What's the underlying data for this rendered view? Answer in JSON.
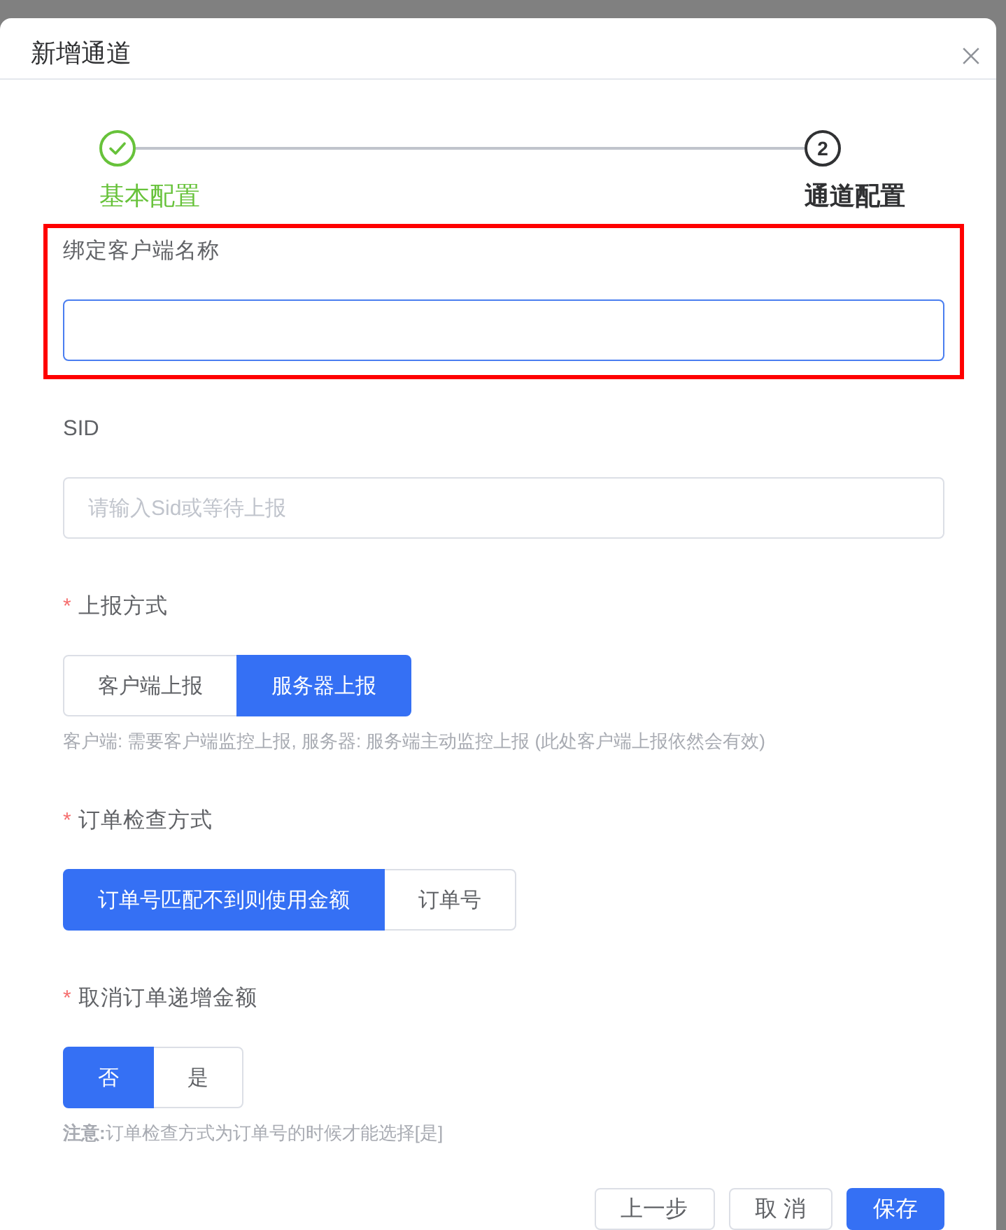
{
  "dialog": {
    "title": "新增通道"
  },
  "steps": [
    {
      "label": "基本配置",
      "finished": true,
      "selected": false
    },
    {
      "number": "2",
      "label": "通道配置",
      "finished": false,
      "selected": true
    }
  ],
  "fields": [
    {
      "kind": "input",
      "label": "绑定客户端名称",
      "focused": true,
      "highlighted": true
    },
    {
      "kind": "input",
      "label": "SID",
      "placeholder": "请输入Sid或等待上报",
      "focused": false,
      "highlighted": false
    },
    {
      "kind": "radio",
      "required_mark": "*",
      "label": "上报方式",
      "highlighted": false,
      "options": [
        {
          "label": "客户端上报",
          "selected": false
        },
        {
          "label": "服务器上报",
          "selected": true
        }
      ],
      "hint": "客户端: 需要客户端监控上报, 服务器: 服务端主动监控上报 (此处客户端上报依然会有效)"
    },
    {
      "kind": "radio",
      "required_mark": "*",
      "label": "订单检查方式",
      "highlighted": false,
      "options": [
        {
          "label": "订单号匹配不到则使用金额",
          "selected": true
        },
        {
          "label": "订单号",
          "selected": false
        }
      ]
    },
    {
      "kind": "radio",
      "required_mark": "*",
      "label": "取消订单递增金额",
      "highlighted": false,
      "options": [
        {
          "label": "否",
          "selected": true
        },
        {
          "label": "是",
          "selected": false
        }
      ],
      "hint": "**注意:**订单检查方式为订单号的时候才能选择[是]"
    }
  ],
  "footer": {
    "buttons": [
      {
        "label": "上一步",
        "kind": "default"
      },
      {
        "label": "取 消",
        "kind": "default"
      },
      {
        "label": "保存",
        "kind": "primary"
      }
    ]
  }
}
